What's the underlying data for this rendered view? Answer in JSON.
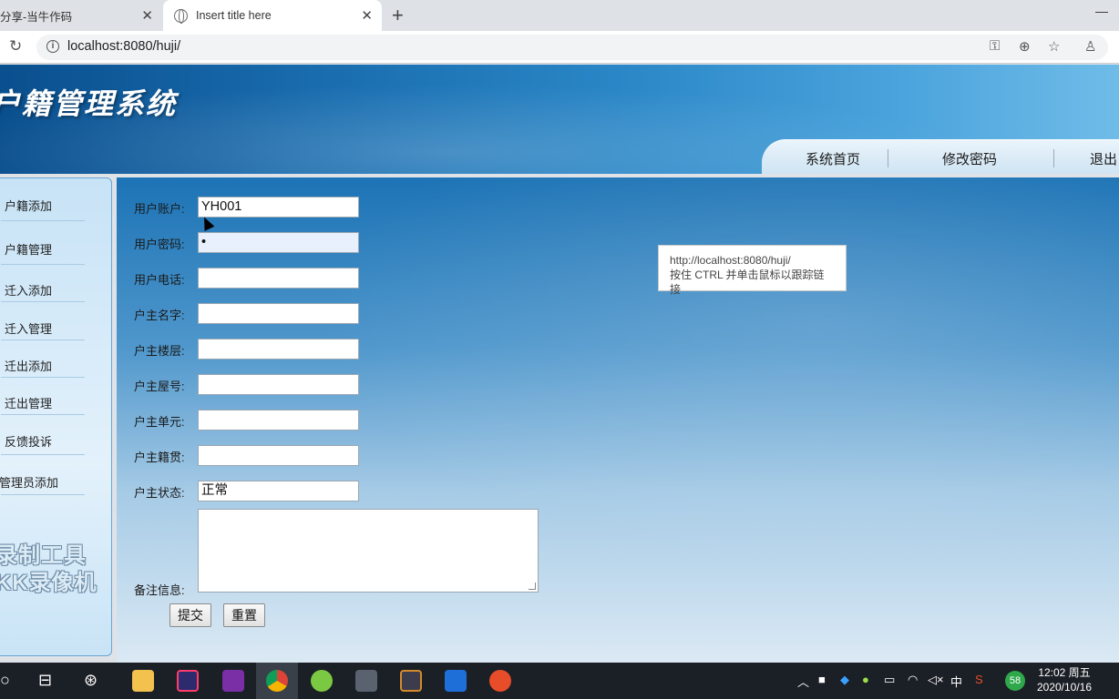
{
  "browser": {
    "tabs": [
      {
        "title": "分享-当牛作码",
        "active": false
      },
      {
        "title": "Insert title here",
        "active": true
      }
    ],
    "url": "localhost:8080/huji/"
  },
  "header": {
    "system_title": "户籍管理系统",
    "nav": [
      "系统首页",
      "修改密码",
      "退出"
    ]
  },
  "sidebar": {
    "items": [
      "户籍添加",
      "户籍管理",
      "迁入添加",
      "迁入管理",
      "迁出添加",
      "迁出管理",
      "反馈投诉",
      "管理员添加"
    ],
    "watermark_line1": "录制工具",
    "watermark_line2": "KK录像机"
  },
  "form": {
    "fields": [
      {
        "label": "用户账户:",
        "value": "YH001"
      },
      {
        "label": "用户密码:",
        "value": "•"
      },
      {
        "label": "用户电话:",
        "value": ""
      },
      {
        "label": "户主名字:",
        "value": ""
      },
      {
        "label": "户主楼层:",
        "value": ""
      },
      {
        "label": "户主屋号:",
        "value": ""
      },
      {
        "label": "户主单元:",
        "value": ""
      },
      {
        "label": "户主籍贯:",
        "value": ""
      },
      {
        "label": "户主状态:",
        "value": "正常"
      }
    ],
    "notes_label": "备注信息:",
    "submit_label": "提交",
    "reset_label": "重置"
  },
  "tooltip": {
    "line1": "http://localhost:8080/huji/",
    "line2": "按住 CTRL 并单击鼠标以跟踪链接"
  },
  "taskbar": {
    "tray_lang": "中",
    "badge": "58",
    "time": "12:02 周五",
    "date": "2020/10/16"
  },
  "colors": {
    "header_dark": "#0a4f8e",
    "header_light": "#6fbce8",
    "sidebar_bg": "#c7e3f6",
    "taskbar_bg": "#1b1f26"
  }
}
